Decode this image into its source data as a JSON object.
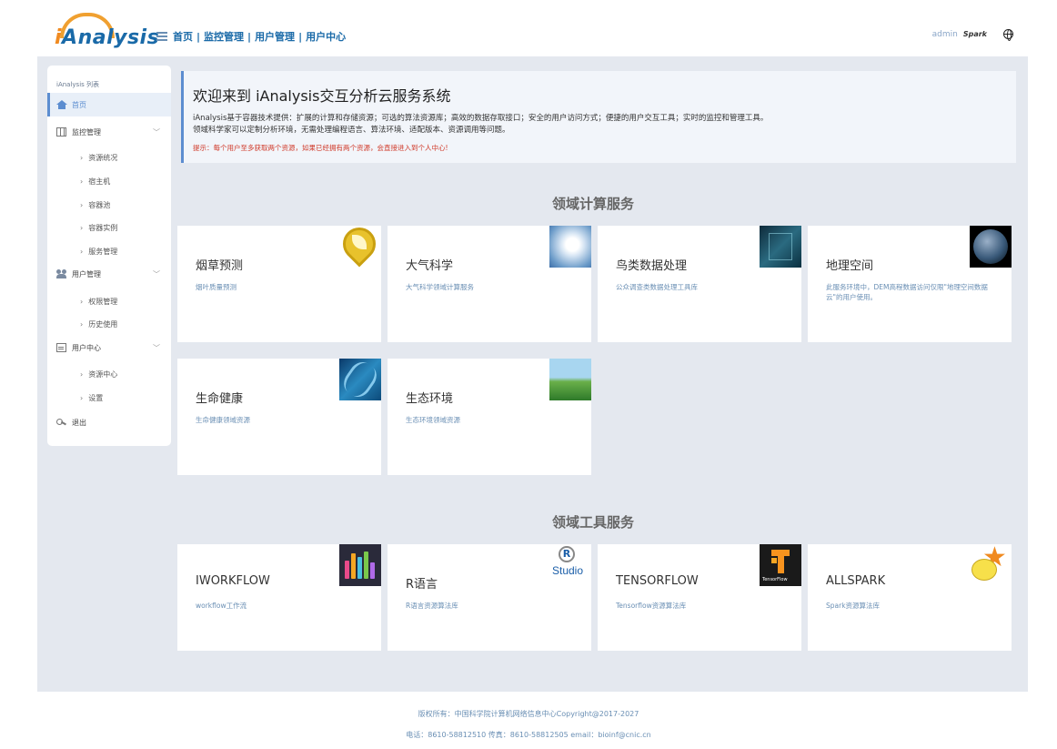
{
  "header": {
    "logo": "iAnalysis",
    "nav": [
      "首页",
      "监控管理",
      "用户管理",
      "用户中心"
    ],
    "user": "admin",
    "spark_label": "Spark"
  },
  "sidebar": {
    "title": "iAnalysis 列表",
    "items": {
      "home": "首页",
      "monitor": "监控管理",
      "monitor_subs": [
        "资源统况",
        "宿主机",
        "容器池",
        "容器实例",
        "服务管理"
      ],
      "users": "用户管理",
      "users_subs": [
        "权限管理",
        "历史使用"
      ],
      "center": "用户中心",
      "center_subs": [
        "资源中心",
        "设置"
      ],
      "logout": "退出"
    }
  },
  "welcome": {
    "title": "欢迎来到 iAnalysis交互分析云服务系统",
    "line1": "iAnalysis基于容器技术提供：扩展的计算和存储资源；可选的算法资源库；高效的数据存取接口；安全的用户访问方式；便捷的用户交互工具；实时的监控和管理工具。",
    "line2": "领域科学家可以定制分析环境，无需处理编程语言、算法环境、适配版本、资源调用等问题。",
    "tip": "提示：每个用户至多获取两个资源，如果已经拥有两个资源，会直接进入到个人中心!"
  },
  "compute": {
    "title": "领域计算服务",
    "cards": [
      {
        "title": "烟草预测",
        "desc": "烟叶质量预测"
      },
      {
        "title": "大气科学",
        "desc": "大气科学领域计算服务"
      },
      {
        "title": "鸟类数据处理",
        "desc": "公众调查类数据处理工具库"
      },
      {
        "title": "地理空间",
        "desc": "此服务环境中，DEM高程数据访问仅限\"地理空间数据云\"的用户使用。"
      },
      {
        "title": "生命健康",
        "desc": "生命健康领域资源"
      },
      {
        "title": "生态环境",
        "desc": "生态环境领域资源"
      }
    ]
  },
  "tools": {
    "title": "领域工具服务",
    "cards": [
      {
        "title": "IWORKFLOW",
        "desc": "workflow工作流"
      },
      {
        "title": "R语言",
        "desc": "R语言资源算法库"
      },
      {
        "title": "TENSORFLOW",
        "desc": "Tensorflow资源算法库"
      },
      {
        "title": "ALLSPARK",
        "desc": "Spark资源算法库"
      }
    ],
    "rstudio_text": "Studio",
    "tensorflow_logo_text": "TensorFlow"
  },
  "footer": {
    "line1": "版权所有：中国科学院计算机网络信息中心Copyright@2017-2027",
    "line2": "电话：8610-58812510  传真：8610-58812505   email：bioinf@cnic.cn"
  }
}
